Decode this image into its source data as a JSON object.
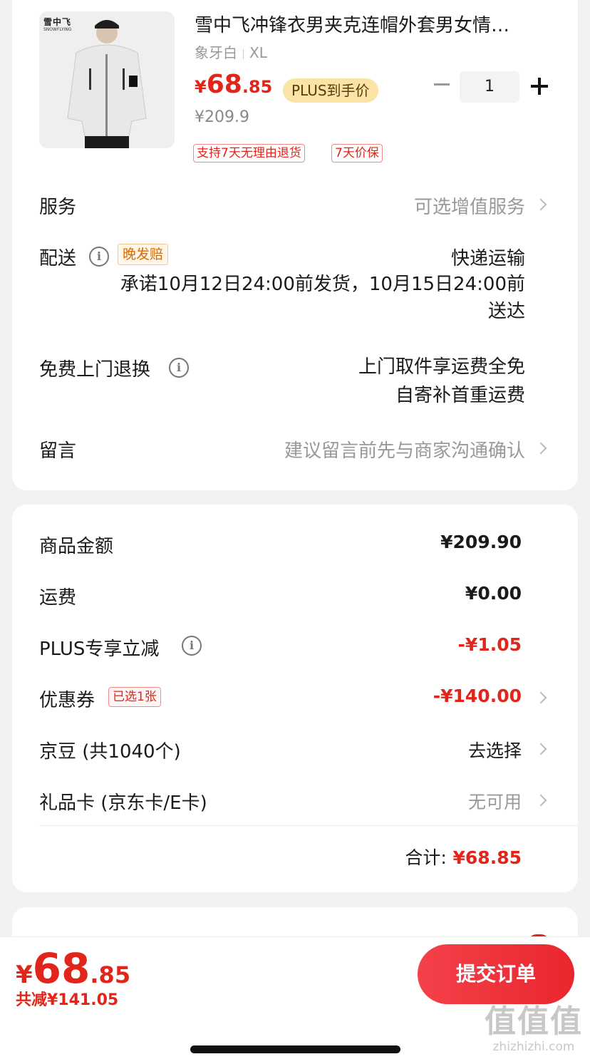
{
  "product": {
    "brand_logo": "雪中飞",
    "brand_sub": "SNOWFLYING",
    "title": "雪中飞冲锋衣男夹克连帽外套男女情…",
    "color": "象牙白",
    "size": "XL",
    "price_yen": "¥",
    "price_int": "68",
    "price_dec": ".85",
    "plus_badge": "PLUS到手价",
    "original_price": "¥209.9",
    "tags": [
      "支持7天无理由退货",
      "7天价保"
    ],
    "quantity": "1"
  },
  "service": {
    "label": "服务",
    "value": "可选增值服务"
  },
  "delivery": {
    "label": "配送",
    "badge": "晚发赔",
    "method": "快递运输",
    "promise": "承诺10月12日24:00前发货，10月15日24:00前送达"
  },
  "return_service": {
    "label": "免费上门退换",
    "line1": "上门取件享运费全免",
    "line2": "自寄补首重运费"
  },
  "message": {
    "label": "留言",
    "placeholder": "建议留言前先与商家沟通确认"
  },
  "amounts": {
    "goods_label": "商品金额",
    "goods_value": "¥209.90",
    "shipping_label": "运费",
    "shipping_value": "¥0.00",
    "plus_label": "PLUS专享立减",
    "plus_value": "-¥1.05",
    "coupon_label": "优惠券",
    "coupon_badge": "已选1张",
    "coupon_value": "-¥140.00",
    "beans_label": "京豆 (共1040个)",
    "beans_value": "去选择",
    "giftcard_label": "礼品卡 (京东卡/E卡)",
    "giftcard_value": "无可用",
    "total_label": "合计:",
    "total_value": "¥68.85"
  },
  "bottom": {
    "yen": "¥",
    "int": "68",
    "dec": ".85",
    "saved": "共减¥141.05",
    "submit": "提交订单"
  },
  "watermark": {
    "big": "值值值",
    "small": "zhizhizhi.com"
  },
  "colors": {
    "accent_red": "#e1251b",
    "plus_gold": "#fbe3a6",
    "background": "#f2f2f2"
  }
}
